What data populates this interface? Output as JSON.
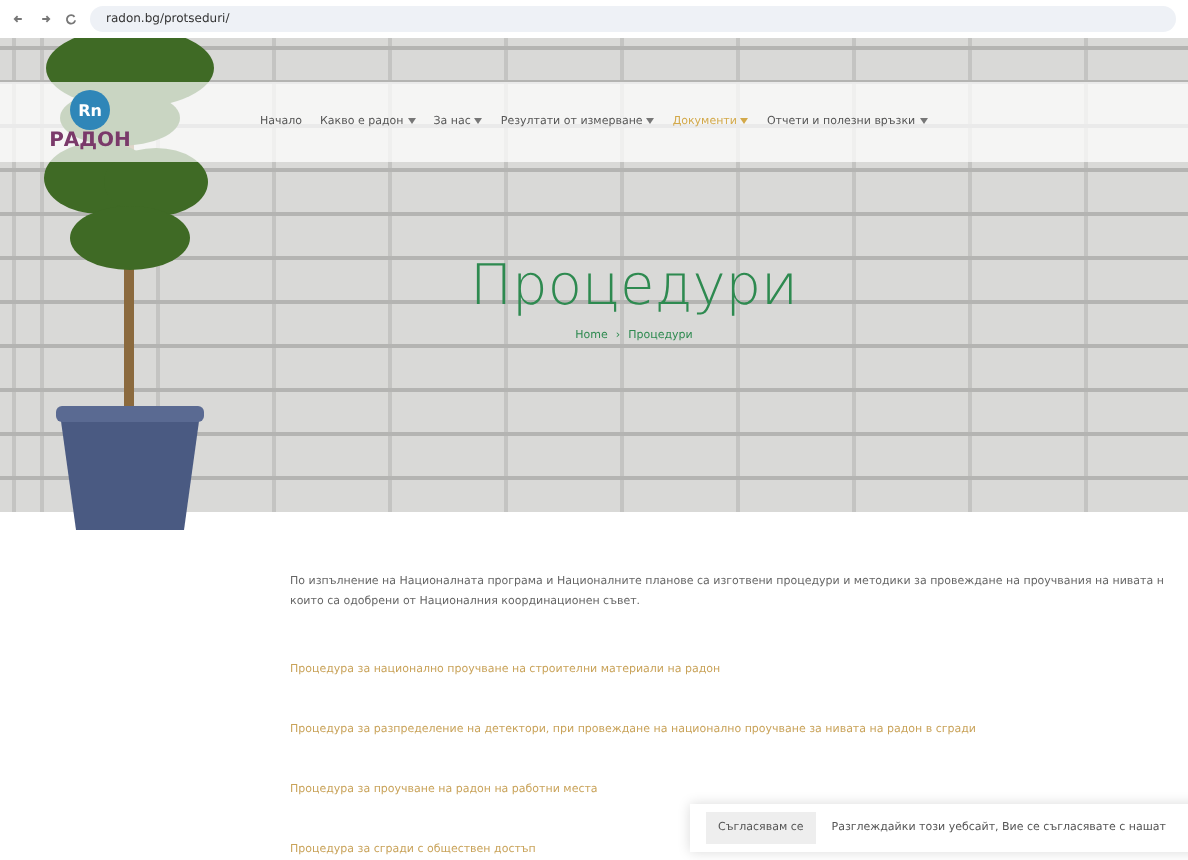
{
  "browser": {
    "url": "radon.bg/protseduri/"
  },
  "header": {
    "logo_badge": "Rn",
    "logo_text": "РАДОН",
    "nav": [
      {
        "label": "Начало",
        "dropdown": false,
        "selected": false
      },
      {
        "label": "Какво е радон",
        "dropdown": true,
        "selected": false
      },
      {
        "label": "За нас",
        "dropdown": true,
        "selected": false
      },
      {
        "label": "Резултати от измерване",
        "dropdown": true,
        "selected": false
      },
      {
        "label": "Документи",
        "dropdown": true,
        "selected": true
      },
      {
        "label": "Отчети и полезни връзки",
        "dropdown": true,
        "selected": false
      }
    ]
  },
  "hero": {
    "title": "Процедури",
    "breadcrumb": [
      "Home",
      "Процедури"
    ],
    "breadcrumb_separator": "›"
  },
  "content": {
    "intro": "По изпълнение на Националната програма и Националните планове са изготвени процедури и методики за провеждане на проучвания на нивата н които са одобрени от Националния координационен съвет.",
    "links": [
      "Процедура за национално проучване на строителни материали на радон",
      "Процедура за разпределение на детектори, при провеждане на национално проучване за нивата на радон в сгради",
      "Процедура за проучване на радон на работни места",
      "Процедура за сгради с обществен достъп"
    ]
  },
  "cookie_bar": {
    "button": "Съгласявам се",
    "text": "Разглеждайки този уебсайт, Вие се съгласявате с нашат"
  }
}
